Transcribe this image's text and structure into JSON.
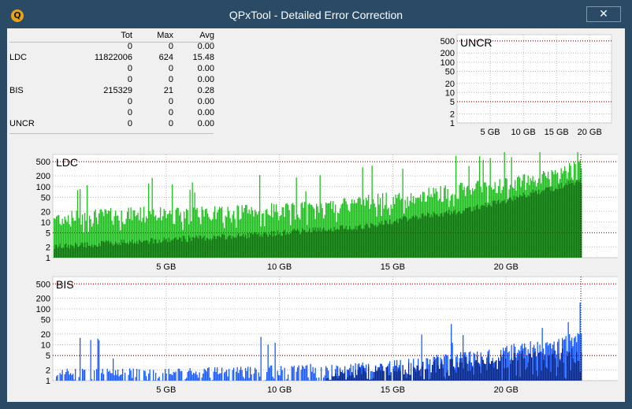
{
  "window": {
    "title": "QPxTool - Detailed Error Correction",
    "icon_letter": "Q",
    "close_glyph": "✕"
  },
  "stats": {
    "headers": [
      "",
      "Tot",
      "Max",
      "Avg"
    ],
    "rows": [
      [
        "",
        "0",
        "0",
        "0.00"
      ],
      [
        "LDC",
        "11822006",
        "624",
        "15.48"
      ],
      [
        "",
        "0",
        "0",
        "0.00"
      ],
      [
        "",
        "0",
        "0",
        "0.00"
      ],
      [
        "BIS",
        "215329",
        "21",
        "0.28"
      ],
      [
        "",
        "0",
        "0",
        "0.00"
      ],
      [
        "",
        "0",
        "0",
        "0.00"
      ],
      [
        "UNCR",
        "0",
        "0",
        "0.00"
      ]
    ]
  },
  "chart_data": [
    {
      "type": "bar",
      "title": "UNCR",
      "y_scale": "log",
      "y_ticks": [
        "500",
        "200",
        "100",
        "50",
        "20",
        "10",
        "5",
        "2",
        "1"
      ],
      "x_ticks": [
        "5 GB",
        "10 GB",
        "15 GB",
        "20 GB"
      ],
      "xlim": [
        0,
        23.3
      ],
      "reference_lines": [
        500,
        5
      ],
      "colors": {
        "background": "#ffffff",
        "reference": "#cc0000"
      },
      "series": [
        {
          "name": "UNCR",
          "values": [
            0
          ]
        }
      ]
    },
    {
      "type": "bar",
      "title": "LDC",
      "y_scale": "log",
      "y_ticks": [
        "500",
        "200",
        "100",
        "50",
        "20",
        "10",
        "5",
        "2",
        "1"
      ],
      "x_ticks": [
        "5 GB",
        "10 GB",
        "15 GB",
        "20 GB"
      ],
      "xlim": [
        0,
        25
      ],
      "data_end_gb": 23.3,
      "reference_lines": [
        500,
        5
      ],
      "colors": {
        "fill": "#1fbf1f",
        "dark": "#0b6a0b",
        "background": "#ffffff"
      },
      "max_profile": {
        "x_gb": [
          0,
          2,
          4,
          6,
          8,
          10,
          12,
          14,
          16,
          18,
          20,
          22,
          23.3
        ],
        "values": [
          18,
          22,
          25,
          24,
          28,
          32,
          35,
          55,
          75,
          120,
          160,
          280,
          600
        ]
      },
      "avg_profile": {
        "x_gb": [
          0,
          4,
          8,
          10,
          14,
          18,
          20,
          22,
          23.3
        ],
        "values": [
          2,
          3,
          4,
          5,
          8,
          20,
          40,
          90,
          150
        ]
      }
    },
    {
      "type": "bar",
      "title": "BIS",
      "y_scale": "log",
      "y_ticks": [
        "500",
        "200",
        "100",
        "50",
        "20",
        "10",
        "5",
        "2",
        "1"
      ],
      "x_ticks": [
        "5 GB",
        "10 GB",
        "15 GB",
        "20 GB"
      ],
      "xlim": [
        0,
        25
      ],
      "data_end_gb": 23.3,
      "reference_lines": [
        500,
        5
      ],
      "colors": {
        "fill": "#1a5cff",
        "dark": "#0a2a8c",
        "background": "#ffffff"
      },
      "max_profile": {
        "x_gb": [
          0,
          5,
          10,
          14,
          16,
          18,
          20,
          22,
          23.3
        ],
        "values": [
          2,
          2,
          2.5,
          3,
          4,
          6,
          9,
          14,
          21
        ]
      }
    }
  ]
}
